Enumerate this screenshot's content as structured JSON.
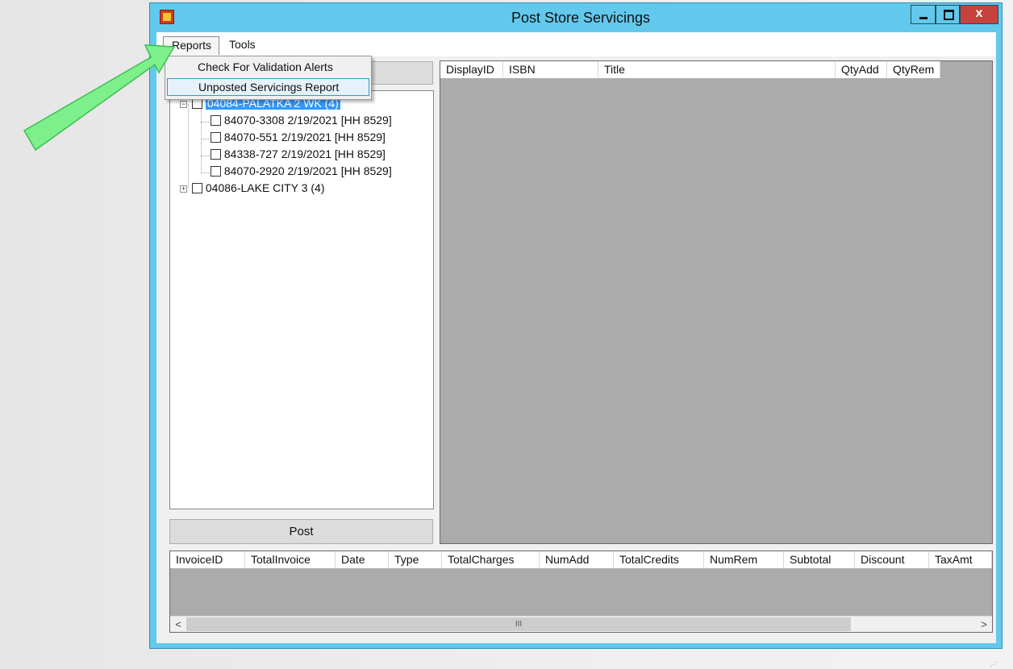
{
  "window": {
    "title": "Post Store Servicings"
  },
  "menu": {
    "reports": "Reports",
    "tools": "Tools"
  },
  "reports_dropdown": {
    "items": [
      "Check For Validation Alerts",
      "Unposted Servicings Report"
    ]
  },
  "tree": {
    "nodes": [
      {
        "label": "04084-PALATKA 2 WK (4)",
        "expanded": true,
        "selected": true,
        "children": [
          "84070-3308 2/19/2021 [HH 8529]",
          "84070-551 2/19/2021 [HH 8529]",
          "84338-727 2/19/2021 [HH 8529]",
          "84070-2920 2/19/2021 [HH 8529]"
        ]
      },
      {
        "label": "04086-LAKE CITY  3 (4)",
        "expanded": false,
        "selected": false
      }
    ]
  },
  "post_button": "Post",
  "detail_grid": {
    "columns": [
      "DisplayID",
      "ISBN",
      "Title",
      "QtyAdd",
      "QtyRem"
    ]
  },
  "invoice_grid": {
    "columns": [
      "InvoiceID",
      "TotalInvoice",
      "Date",
      "Type",
      "TotalCharges",
      "NumAdd",
      "TotalCredits",
      "NumRem",
      "Subtotal",
      "Discount",
      "TaxAmt"
    ]
  },
  "scrollbar": {
    "left": "<",
    "right": ">",
    "grip": "III"
  },
  "colors": {
    "titlebar": "#62c9ec",
    "close_button": "#c7423d",
    "grid_bg": "#ababab",
    "selection": "#3399ff",
    "arrow": "#7df08c"
  }
}
